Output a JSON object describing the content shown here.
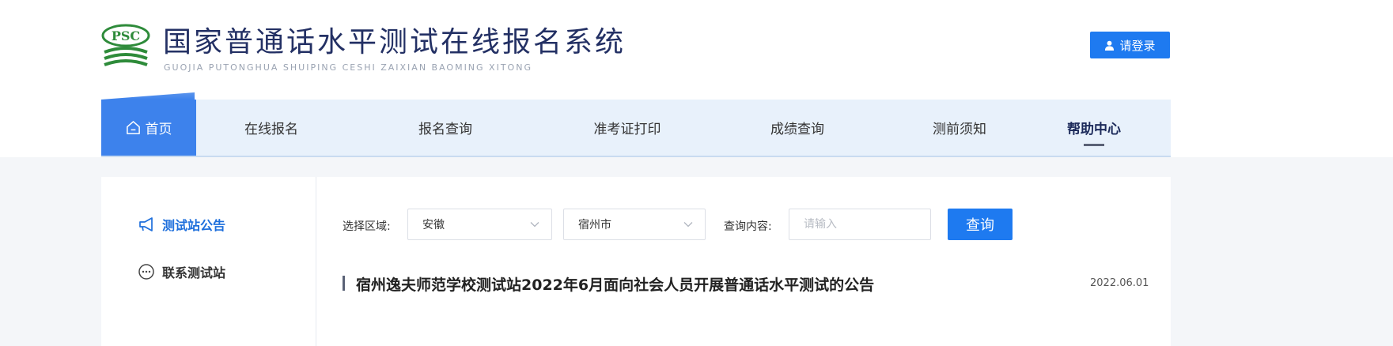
{
  "header": {
    "title": "国家普通话水平测试在线报名系统",
    "subtitle": "GUOJIA PUTONGHUA SHUIPING CESHI ZAIXIAN BAOMING XITONG",
    "logo_text": "PSC",
    "login_label": "请登录"
  },
  "nav": {
    "items": [
      {
        "label": "首页"
      },
      {
        "label": "在线报名"
      },
      {
        "label": "报名查询"
      },
      {
        "label": "准考证打印"
      },
      {
        "label": "成绩查询"
      },
      {
        "label": "测前须知"
      },
      {
        "label": "帮助中心"
      }
    ]
  },
  "sidebar": {
    "items": [
      {
        "label": "测试站公告",
        "icon": "megaphone-icon"
      },
      {
        "label": "联系测试站",
        "icon": "chat-bubble-icon"
      }
    ]
  },
  "filter": {
    "region_label": "选择区域:",
    "province": "安徽",
    "city": "宿州市",
    "query_label": "查询内容:",
    "query_placeholder": "请输入",
    "search_label": "查询"
  },
  "notices": [
    {
      "title": "宿州逸夫师范学校测试站2022年6月面向社会人员开展普通话水平测试的公告",
      "date": "2022.06.01"
    }
  ],
  "colors": {
    "primary": "#1e7af0",
    "nav_bg": "#e8f1fb",
    "brand_green": "#2e8b3a",
    "title_navy": "#233064"
  }
}
